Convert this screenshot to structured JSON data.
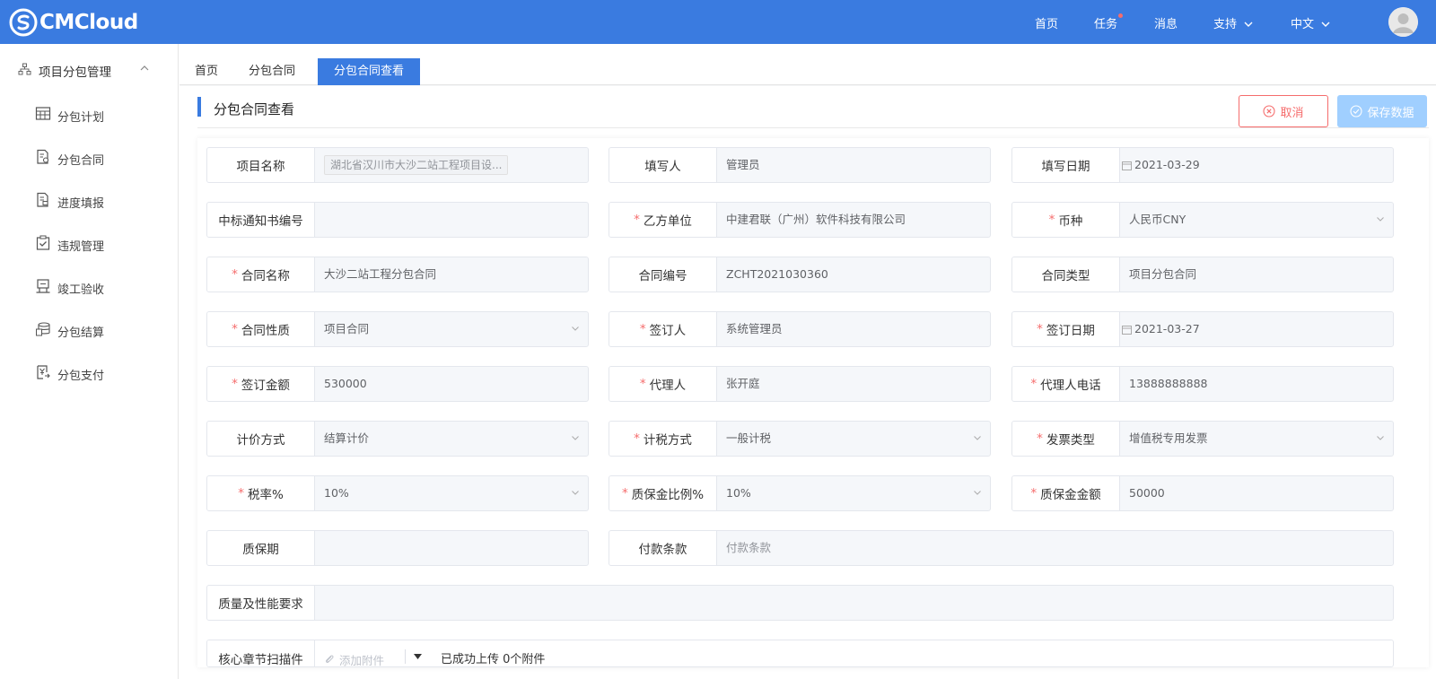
{
  "app": {
    "logo_text": "CMCloud"
  },
  "topnav": {
    "home": "首页",
    "tasks": "任务",
    "messages": "消息",
    "support": "支持",
    "language": "中文"
  },
  "sidebar": {
    "group": "项目分包管理",
    "items": [
      {
        "label": "分包计划",
        "icon": "table-icon"
      },
      {
        "label": "分包合同",
        "icon": "contract-icon"
      },
      {
        "label": "进度填报",
        "icon": "progress-report-icon"
      },
      {
        "label": "违规管理",
        "icon": "checklist-icon"
      },
      {
        "label": "竣工验收",
        "icon": "acceptance-icon"
      },
      {
        "label": "分包结算",
        "icon": "coins-icon"
      },
      {
        "label": "分包支付",
        "icon": "payment-icon"
      }
    ]
  },
  "tabs": [
    {
      "label": "首页"
    },
    {
      "label": "分包合同"
    },
    {
      "label": "分包合同查看",
      "active": true
    }
  ],
  "page": {
    "title": "分包合同查看",
    "cancel_label": "取消",
    "save_label": "保存数据"
  },
  "form": {
    "project_name": {
      "label": "项目名称",
      "value": "湖北省汉川市大沙二站工程项目设..."
    },
    "filler": {
      "label": "填写人",
      "value": "管理员"
    },
    "fill_date": {
      "label": "填写日期",
      "value": "2021-03-29"
    },
    "bid_notice_no": {
      "label": "中标通知书编号",
      "value": ""
    },
    "party_b": {
      "label": "乙方单位",
      "value": "中建君联（广州）软件科技有限公司",
      "required": true
    },
    "currency": {
      "label": "币种",
      "value": "人民币CNY",
      "required": true
    },
    "contract_name": {
      "label": "合同名称",
      "value": "大沙二站工程分包合同",
      "required": true
    },
    "contract_no": {
      "label": "合同编号",
      "value": "ZCHT2021030360"
    },
    "contract_type": {
      "label": "合同类型",
      "value": "项目分包合同"
    },
    "contract_nature": {
      "label": "合同性质",
      "value": "项目合同",
      "required": true
    },
    "signer": {
      "label": "签订人",
      "value": "系统管理员",
      "required": true
    },
    "sign_date": {
      "label": "签订日期",
      "value": "2021-03-27",
      "required": true
    },
    "sign_amount": {
      "label": "签订金额",
      "value": "530000",
      "required": true
    },
    "agent": {
      "label": "代理人",
      "value": "张开庭",
      "required": true
    },
    "agent_phone": {
      "label": "代理人电话",
      "value": "13888888888",
      "required": true
    },
    "pricing_method": {
      "label": "计价方式",
      "value": "结算计价"
    },
    "tax_method": {
      "label": "计税方式",
      "value": "一般计税",
      "required": true
    },
    "invoice_type": {
      "label": "发票类型",
      "value": "增值税专用发票",
      "required": true
    },
    "tax_rate": {
      "label": "税率%",
      "value": "10%",
      "required": true
    },
    "retention_ratio": {
      "label": "质保金比例%",
      "value": "10%",
      "required": true
    },
    "retention_amount": {
      "label": "质保金金额",
      "value": "50000",
      "required": true
    },
    "warranty_period": {
      "label": "质保期",
      "value": ""
    },
    "payment_terms": {
      "label": "付款条款",
      "placeholder": "付款条款"
    },
    "quality_req": {
      "label": "质量及性能要求",
      "value": ""
    },
    "core_scan": {
      "label": "核心章节扫描件",
      "add_label": "添加附件",
      "upload_status": "已成功上传 0个附件"
    }
  },
  "colors": {
    "primary": "#3a7be0",
    "danger": "#f56c6c",
    "disabled": "#a0cfff"
  }
}
